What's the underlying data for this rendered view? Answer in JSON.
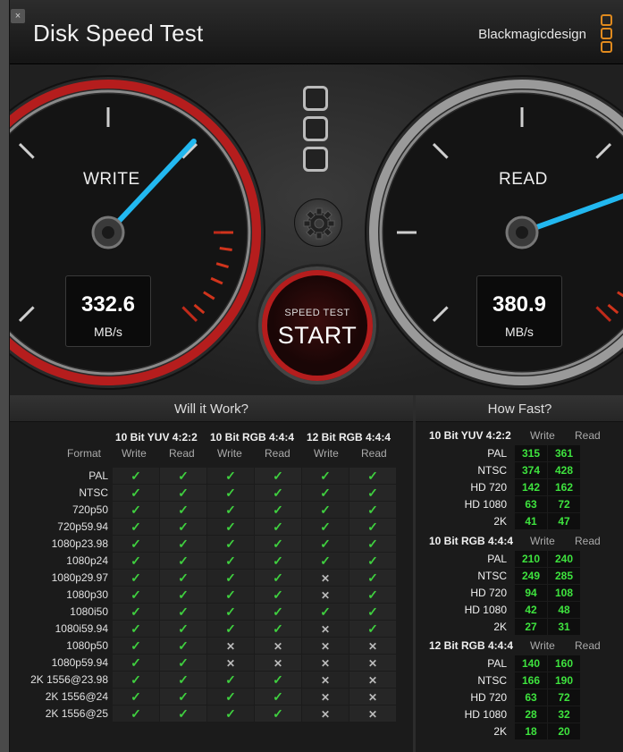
{
  "window": {
    "title": "Disk Speed Test",
    "brand": "Blackmagicdesign",
    "close_glyph": "×"
  },
  "gauges": {
    "write": {
      "label": "WRITE",
      "value": "332.6",
      "unit": "MB/s",
      "needle_fraction": 0.66
    },
    "read": {
      "label": "READ",
      "value": "380.9",
      "unit": "MB/s",
      "needle_fraction": 0.76
    }
  },
  "start_button": {
    "small_label": "SPEED TEST",
    "big_label": "START"
  },
  "will_it_work": {
    "title": "Will it Work?",
    "format_header": "Format",
    "groups": [
      "10 Bit YUV 4:2:2",
      "10 Bit RGB 4:4:4",
      "12 Bit RGB 4:4:4"
    ],
    "write_label": "Write",
    "read_label": "Read",
    "rows": [
      {
        "format": "PAL",
        "cells": [
          "ok",
          "ok",
          "ok",
          "ok",
          "ok",
          "ok"
        ]
      },
      {
        "format": "NTSC",
        "cells": [
          "ok",
          "ok",
          "ok",
          "ok",
          "ok",
          "ok"
        ]
      },
      {
        "format": "720p50",
        "cells": [
          "ok",
          "ok",
          "ok",
          "ok",
          "ok",
          "ok"
        ]
      },
      {
        "format": "720p59.94",
        "cells": [
          "ok",
          "ok",
          "ok",
          "ok",
          "ok",
          "ok"
        ]
      },
      {
        "format": "1080p23.98",
        "cells": [
          "ok",
          "ok",
          "ok",
          "ok",
          "ok",
          "ok"
        ]
      },
      {
        "format": "1080p24",
        "cells": [
          "ok",
          "ok",
          "ok",
          "ok",
          "ok",
          "ok"
        ]
      },
      {
        "format": "1080p29.97",
        "cells": [
          "ok",
          "ok",
          "ok",
          "ok",
          "no",
          "ok"
        ]
      },
      {
        "format": "1080p30",
        "cells": [
          "ok",
          "ok",
          "ok",
          "ok",
          "no",
          "ok"
        ]
      },
      {
        "format": "1080i50",
        "cells": [
          "ok",
          "ok",
          "ok",
          "ok",
          "ok",
          "ok"
        ]
      },
      {
        "format": "1080i59.94",
        "cells": [
          "ok",
          "ok",
          "ok",
          "ok",
          "no",
          "ok"
        ]
      },
      {
        "format": "1080p50",
        "cells": [
          "ok",
          "ok",
          "no",
          "no",
          "no",
          "no"
        ]
      },
      {
        "format": "1080p59.94",
        "cells": [
          "ok",
          "ok",
          "no",
          "no",
          "no",
          "no"
        ]
      },
      {
        "format": "2K 1556@23.98",
        "cells": [
          "ok",
          "ok",
          "ok",
          "ok",
          "no",
          "no"
        ]
      },
      {
        "format": "2K 1556@24",
        "cells": [
          "ok",
          "ok",
          "ok",
          "ok",
          "no",
          "no"
        ]
      },
      {
        "format": "2K 1556@25",
        "cells": [
          "ok",
          "ok",
          "ok",
          "ok",
          "no",
          "no"
        ]
      }
    ],
    "check_glyph": "✓",
    "cross_glyph": "✕"
  },
  "how_fast": {
    "title": "How Fast?",
    "write_label": "Write",
    "read_label": "Read",
    "sections": [
      {
        "title": "10 Bit YUV 4:2:2",
        "rows": [
          {
            "label": "PAL",
            "write": "315",
            "read": "361"
          },
          {
            "label": "NTSC",
            "write": "374",
            "read": "428"
          },
          {
            "label": "HD 720",
            "write": "142",
            "read": "162"
          },
          {
            "label": "HD 1080",
            "write": "63",
            "read": "72"
          },
          {
            "label": "2K",
            "write": "41",
            "read": "47"
          }
        ]
      },
      {
        "title": "10 Bit RGB 4:4:4",
        "rows": [
          {
            "label": "PAL",
            "write": "210",
            "read": "240"
          },
          {
            "label": "NTSC",
            "write": "249",
            "read": "285"
          },
          {
            "label": "HD 720",
            "write": "94",
            "read": "108"
          },
          {
            "label": "HD 1080",
            "write": "42",
            "read": "48"
          },
          {
            "label": "2K",
            "write": "27",
            "read": "31"
          }
        ]
      },
      {
        "title": "12 Bit RGB 4:4:4",
        "rows": [
          {
            "label": "PAL",
            "write": "140",
            "read": "160"
          },
          {
            "label": "NTSC",
            "write": "166",
            "read": "190"
          },
          {
            "label": "HD 720",
            "write": "63",
            "read": "72"
          },
          {
            "label": "HD 1080",
            "write": "28",
            "read": "32"
          },
          {
            "label": "2K",
            "write": "18",
            "read": "20"
          }
        ]
      }
    ]
  },
  "colors": {
    "needle": "#22b8f0",
    "bezel_red": "#b51d1d",
    "ok_green": "#3fcf3f",
    "value_green": "#3ee33e"
  }
}
